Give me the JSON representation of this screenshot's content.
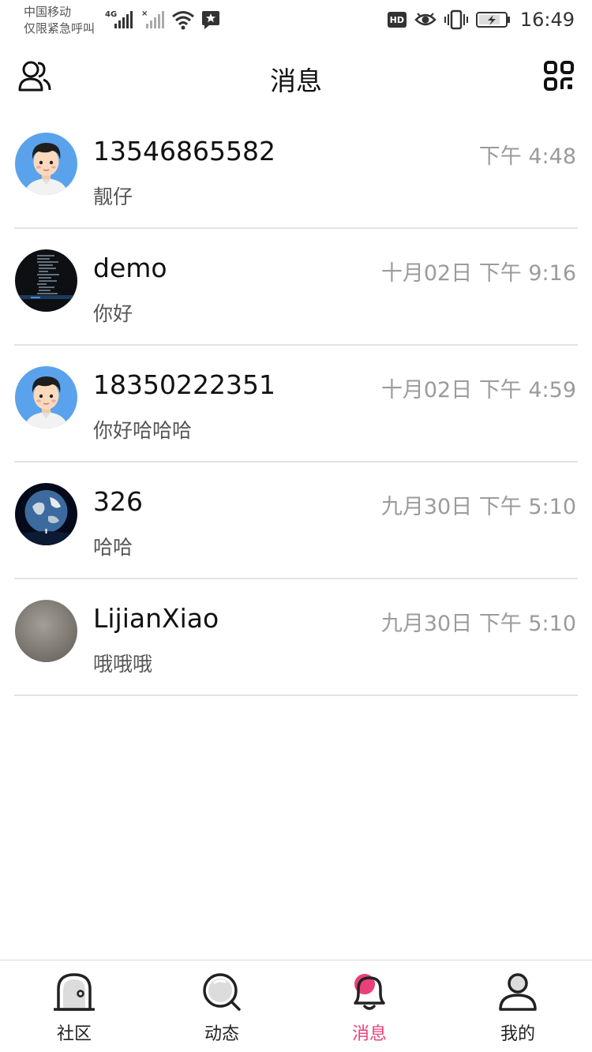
{
  "status_bar": {
    "carrier_line1": "中国移动",
    "carrier_line2": "仅限紧急呼叫",
    "network": "4G",
    "time": "16:49",
    "hd": "HD"
  },
  "header": {
    "title": "消息"
  },
  "messages": [
    {
      "name": "13546865582",
      "time": "下午 4:48",
      "preview": "靓仔",
      "avatar": "cartoon-boy"
    },
    {
      "name": "demo",
      "time": "十月02日 下午 9:16",
      "preview": "你好",
      "avatar": "code-screen"
    },
    {
      "name": "18350222351",
      "time": "十月02日 下午 4:59",
      "preview": "你好哈哈哈",
      "avatar": "cartoon-boy"
    },
    {
      "name": "326",
      "time": "九月30日 下午 5:10",
      "preview": "哈哈",
      "avatar": "earth"
    },
    {
      "name": "LijianXiao",
      "time": "九月30日 下午 5:10",
      "preview": "哦哦哦",
      "avatar": "gray"
    }
  ],
  "bottom_nav": [
    {
      "label": "社区",
      "icon": "community-icon",
      "active": false
    },
    {
      "label": "动态",
      "icon": "search-bubble-icon",
      "active": false
    },
    {
      "label": "消息",
      "icon": "bell-icon",
      "active": true
    },
    {
      "label": "我的",
      "icon": "person-icon",
      "active": false
    }
  ],
  "colors": {
    "accent": "#e8417a",
    "divider": "#e4e4e4",
    "time_text": "#9b9b9b"
  }
}
